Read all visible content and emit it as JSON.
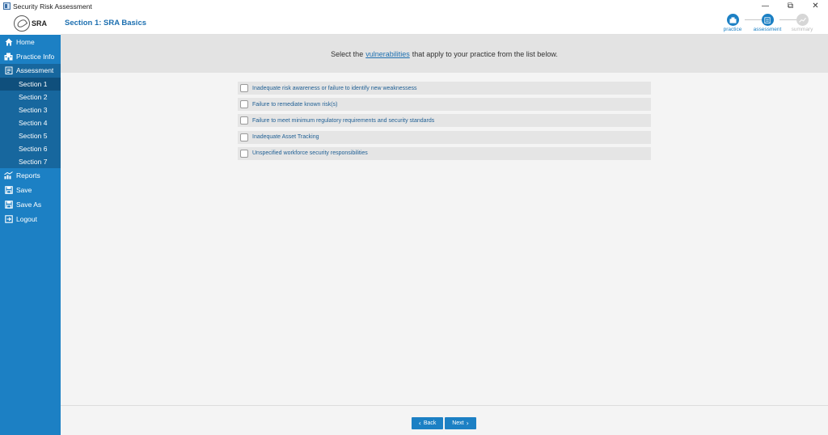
{
  "window": {
    "title": "Security Risk Assessment",
    "minimize": "—",
    "maximize": "⧉",
    "close": "✕"
  },
  "logo": {
    "text": "SRA"
  },
  "sidebar": {
    "items": [
      {
        "label": "Home",
        "icon": "home-icon"
      },
      {
        "label": "Practice Info",
        "icon": "building-icon"
      },
      {
        "label": "Assessment",
        "icon": "clipboard-icon"
      },
      {
        "label": "Reports",
        "icon": "chart-icon"
      },
      {
        "label": "Save",
        "icon": "floppy-icon"
      },
      {
        "label": "Save As",
        "icon": "floppy-icon"
      },
      {
        "label": "Logout",
        "icon": "logout-icon"
      }
    ],
    "sections": [
      "Section 1",
      "Section 2",
      "Section 3",
      "Section 4",
      "Section 5",
      "Section 6",
      "Section 7"
    ],
    "selected_section": "Section 1"
  },
  "header": {
    "section_title": "Section 1: SRA Basics",
    "steps": [
      {
        "label": "practice",
        "state": "done"
      },
      {
        "label": "assessment",
        "state": "done"
      },
      {
        "label": "summary",
        "state": "todo"
      }
    ]
  },
  "main": {
    "instruction_pre": "Select the",
    "instruction_link": "vulnerabilities",
    "instruction_post": "that apply to your practice from the list below.",
    "options": [
      {
        "label": "Inadequate risk awareness or failure to identify new weaknessess",
        "checked": false
      },
      {
        "label": "Failure to remediate known risk(s)",
        "checked": false
      },
      {
        "label": "Failure to meet minimum regulatory requirements and security standards",
        "checked": false
      },
      {
        "label": "Inadequate Asset Tracking",
        "checked": false
      },
      {
        "label": "Unspecified workforce security responsibilities",
        "checked": false
      }
    ]
  },
  "footer": {
    "back_label": "Back",
    "next_label": "Next"
  },
  "colors": {
    "sidebar": "#1c80c4",
    "accent": "#1c6fb0"
  }
}
